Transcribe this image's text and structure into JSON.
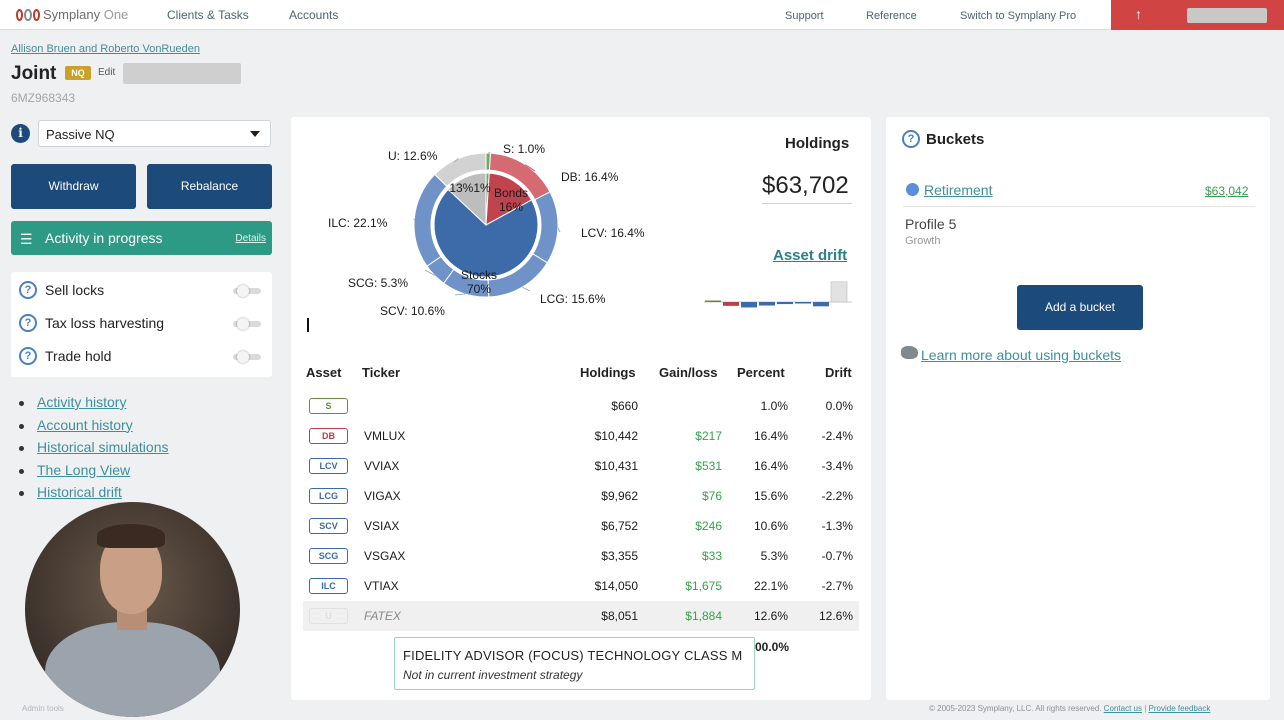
{
  "topnav": {
    "brand": "Symplany",
    "brand_suffix": "One",
    "links": [
      "Clients & Tasks",
      "Accounts"
    ],
    "right_links": [
      "Support",
      "Reference",
      "Switch to Symplany Pro"
    ]
  },
  "account": {
    "client_names": "Allison Bruen and Roberto VonRueden",
    "title": "Joint",
    "badge": "NQ",
    "edit": "Edit",
    "number": "6MZ968343",
    "strategy": "Passive NQ"
  },
  "actions": {
    "withdraw": "Withdraw",
    "rebalance": "Rebalance",
    "activity": "Activity in progress",
    "details": "Details"
  },
  "toggles": [
    {
      "label": "Sell locks",
      "on": false
    },
    {
      "label": "Tax loss harvesting",
      "on": false
    },
    {
      "label": "Trade hold",
      "on": false
    }
  ],
  "links": [
    "Activity history",
    "Account history",
    "Historical simulations",
    "The Long View",
    "Historical drift"
  ],
  "footer": {
    "left": "Admin tools",
    "copyright": "© 2005-2023 Symplany, LLC. All rights reserved.",
    "contact": "Contact us",
    "feedback": "Provide feedback"
  },
  "holdings": {
    "title": "Holdings",
    "amount": "$63,702",
    "drift_link": "Asset drift"
  },
  "chart_data": {
    "type": "pie",
    "inner": [
      {
        "label": "Stocks",
        "pct": "70%",
        "value": 70,
        "color": "#3d6aa8"
      },
      {
        "label": "Bonds",
        "pct": "16%",
        "value": 16,
        "color": "#c0444e"
      },
      {
        "label": "",
        "pct": "13%",
        "value": 13,
        "color": "#bdbdbd"
      },
      {
        "label": "",
        "pct": "1%",
        "value": 1,
        "color": "#6fa86c"
      }
    ],
    "outer": [
      {
        "label": "S: 1.0%",
        "value": 1.0,
        "color": "#6fa86c"
      },
      {
        "label": "DB: 16.4%",
        "value": 16.4,
        "color": "#d56a72"
      },
      {
        "label": "LCV: 16.4%",
        "value": 16.4,
        "color": "#6f92c8"
      },
      {
        "label": "LCG: 15.6%",
        "value": 15.6,
        "color": "#6f92c8"
      },
      {
        "label": "SCV: 10.6%",
        "value": 10.6,
        "color": "#6f92c8"
      },
      {
        "label": "SCG: 5.3%",
        "value": 5.3,
        "color": "#6f92c8"
      },
      {
        "label": "ILC: 22.1%",
        "value": 22.1,
        "color": "#6f92c8"
      },
      {
        "label": "U: 12.6%",
        "value": 12.6,
        "color": "#d2d2d2"
      }
    ]
  },
  "table": {
    "headers": [
      "Asset",
      "Ticker",
      "Holdings",
      "Gain/loss",
      "Percent",
      "Drift"
    ],
    "rows": [
      {
        "asset": "S",
        "ticker": "",
        "holdings": "$660",
        "gain": "",
        "percent": "1.0%",
        "drift": "0.0%",
        "color": "#6a8a3a"
      },
      {
        "asset": "DB",
        "ticker": "VMLUX",
        "holdings": "$10,442",
        "gain": "$217",
        "percent": "16.4%",
        "drift": "-2.4%",
        "color": "#b5414a"
      },
      {
        "asset": "LCV",
        "ticker": "VVIAX",
        "holdings": "$10,431",
        "gain": "$531",
        "percent": "16.4%",
        "drift": "-3.4%",
        "color": "#3d6aa8"
      },
      {
        "asset": "LCG",
        "ticker": "VIGAX",
        "holdings": "$9,962",
        "gain": "$76",
        "percent": "15.6%",
        "drift": "-2.2%",
        "color": "#3d6aa8"
      },
      {
        "asset": "SCV",
        "ticker": "VSIAX",
        "holdings": "$6,752",
        "gain": "$246",
        "percent": "10.6%",
        "drift": "-1.3%",
        "color": "#3d6aa8"
      },
      {
        "asset": "SCG",
        "ticker": "VSGAX",
        "holdings": "$3,355",
        "gain": "$33",
        "percent": "5.3%",
        "drift": "-0.7%",
        "color": "#3d6aa8"
      },
      {
        "asset": "ILC",
        "ticker": "VTIAX",
        "holdings": "$14,050",
        "gain": "$1,675",
        "percent": "22.1%",
        "drift": "-2.7%",
        "color": "#3d6aa8"
      },
      {
        "asset": "U",
        "ticker": "FATEX",
        "holdings": "$8,051",
        "gain": "$1,884",
        "percent": "12.6%",
        "drift": "12.6%",
        "color": "#cccccc"
      }
    ],
    "total_percent": "00.0%"
  },
  "tooltip": {
    "title": "FIDELITY ADVISOR (FOCUS) TECHNOLOGY CLASS M",
    "subtitle": "Not in current investment strategy"
  },
  "buckets": {
    "title": "Buckets",
    "name": "Retirement",
    "amount": "$63,042",
    "profile": "Profile 5",
    "profile_sub": "Growth",
    "add": "Add a bucket",
    "learn": "Learn more about using buckets"
  }
}
